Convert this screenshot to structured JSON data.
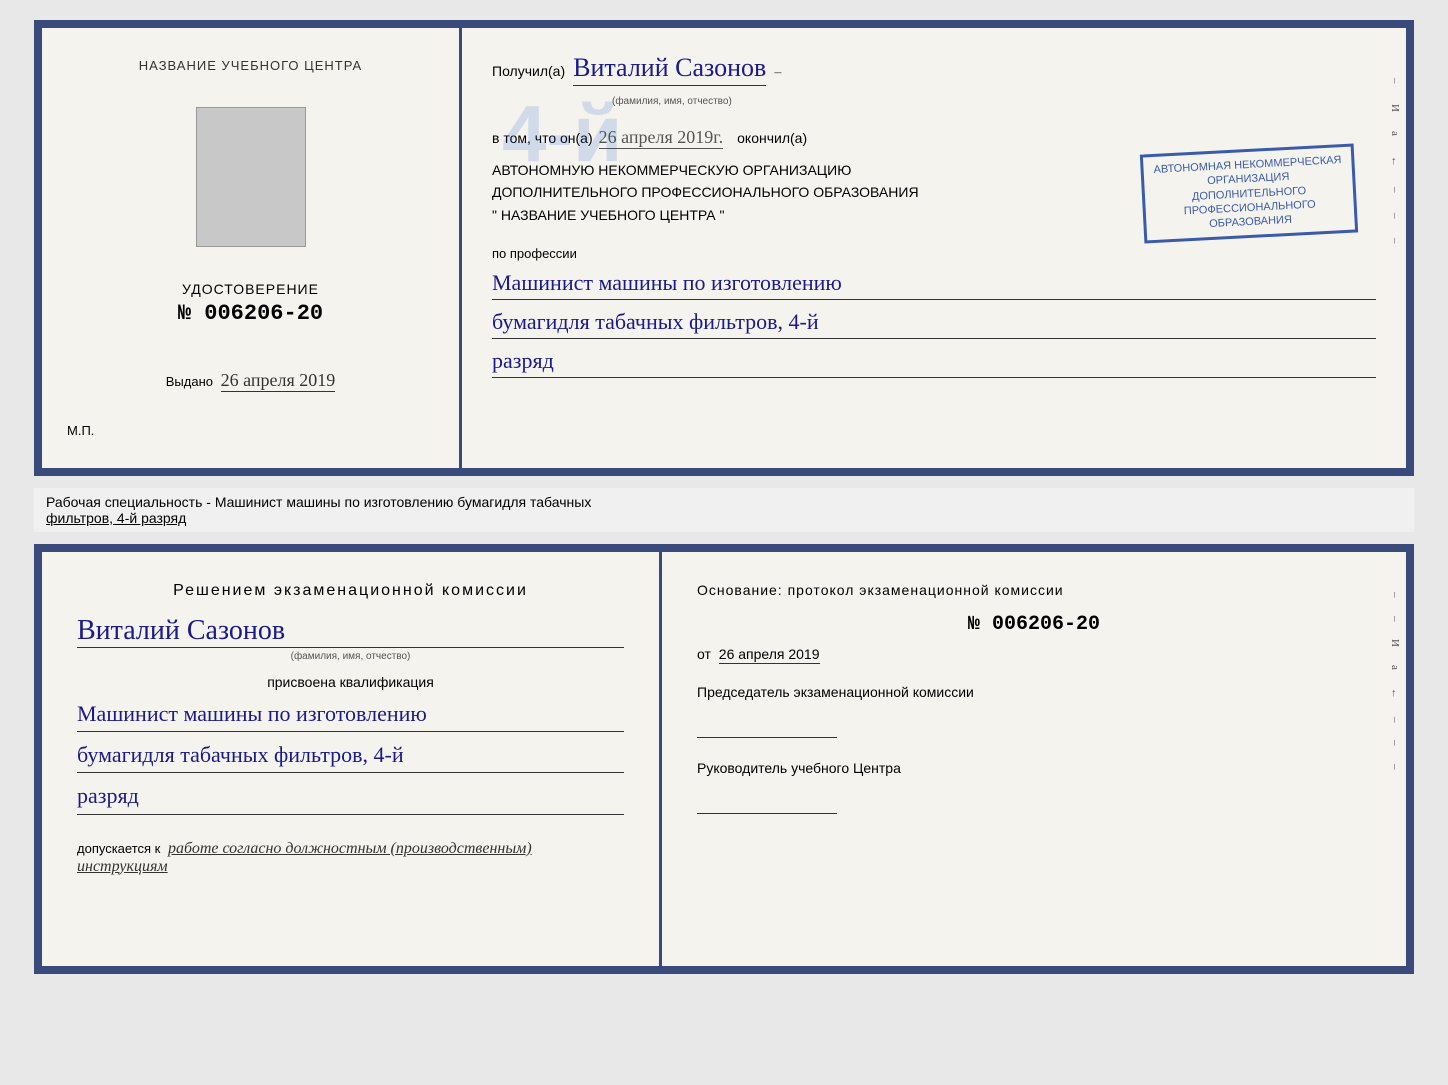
{
  "topDoc": {
    "left": {
      "centerTitle": "НАЗВАНИЕ УЧЕБНОГО ЦЕНТРА",
      "udostoverenie": "УДОСТОВЕРЕНИЕ",
      "number": "№ 006206-20",
      "vydano": "Выдано",
      "vydanoDate": "26 апреля 2019",
      "mp": "М.П."
    },
    "right": {
      "poluchilLabel": "Получил(а)",
      "recipientName": "Виталий Сазонов",
      "nameSub": "(фамилия, имя, отчество)",
      "dash1": "–",
      "vtomLabel": "в том, что он(а)",
      "vtomDate": "26 апреля 2019г.",
      "okonchilLabel": "окончил(а)",
      "bigNumber": "4-й",
      "orgLine1": "АВТОНОМНУЮ НЕКОММЕРЧЕСКУЮ ОРГАНИЗАЦИЮ",
      "orgLine2": "ДОПОЛНИТЕЛЬНОГО ПРОФЕССИОНАЛЬНОГО ОБРАЗОВАНИЯ",
      "orgLine3": "\" НАЗВАНИЕ УЧЕБНОГО ЦЕНТРА \"",
      "stampLines": [
        "АВТОНОМНАЯ НЕКОММЕРЧЕСКАЯ",
        "ОРГАНИЗАЦИЯ",
        "ДОПОЛНИТЕЛЬНОГО",
        "ПРОФЕССИОНАЛЬНОГО",
        "ОБРАЗОВАНИЯ"
      ],
      "poProfessii": "по профессии",
      "profession1": "Машинист машины по изготовлению",
      "profession2": "бумагидля табачных фильтров, 4-й",
      "profession3": "разряд",
      "sideMarks": [
        "–",
        "И",
        "а",
        "←",
        "–",
        "–",
        "–"
      ]
    }
  },
  "labelBar": {
    "text": "Рабочая специальность - Машинист машины по изготовлению бумагидля табачных",
    "underlineText": "фильтров, 4-й разряд"
  },
  "bottomDoc": {
    "left": {
      "resheniemTitle": "Решением  экзаменационной  комиссии",
      "name": "Виталий Сазонов",
      "nameSub": "(фамилия, имя, отчество)",
      "prisvoenLabel": "присвоена квалификация",
      "prof1": "Машинист машины по изготовлению",
      "prof2": "бумагидля табачных фильтров, 4-й",
      "prof3": "разряд",
      "dopuskaetsyaLabel": "допускается к",
      "dopuskaetsyaText": "работе согласно должностным (производственным) инструкциям"
    },
    "right": {
      "osnovanie": "Основание: протокол экзаменационной  комиссии",
      "number": "№  006206-20",
      "otLabel": "от",
      "otDate": "26 апреля 2019",
      "predsedatelTitle": "Председатель экзаменационной комиссии",
      "rukovoditelTitle": "Руководитель учебного Центра",
      "sideMarks": [
        "–",
        "–",
        "И",
        "а",
        "←",
        "–",
        "–",
        "–"
      ]
    }
  }
}
